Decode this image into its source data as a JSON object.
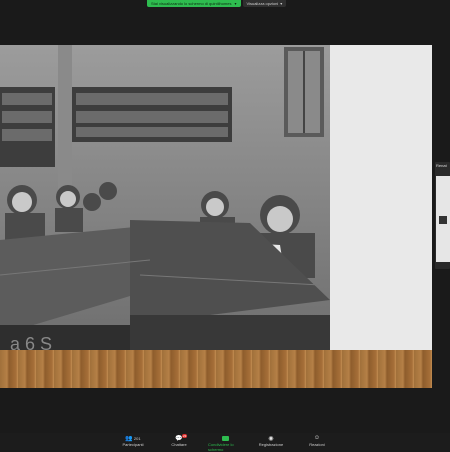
{
  "share_banner": {
    "status_text": "Stai visualizzando lo schermo di quintilhomes",
    "view_options_label": "Visualizza opzioni"
  },
  "thumbnail": {
    "title": "Renat"
  },
  "toolbar": {
    "items": [
      {
        "label": "Partecipanti",
        "count": "201",
        "icon": "participants-icon"
      },
      {
        "label": "Chattare",
        "badge": "23",
        "icon": "chat-icon"
      },
      {
        "label": "Condividere lo schermo",
        "icon": "share-screen-icon"
      },
      {
        "label": "Registrazione",
        "icon": "record-icon"
      },
      {
        "label": "Reazioni",
        "icon": "reactions-icon"
      }
    ]
  },
  "colors": {
    "accent": "#2ebc4f",
    "badge": "#e0312f"
  }
}
